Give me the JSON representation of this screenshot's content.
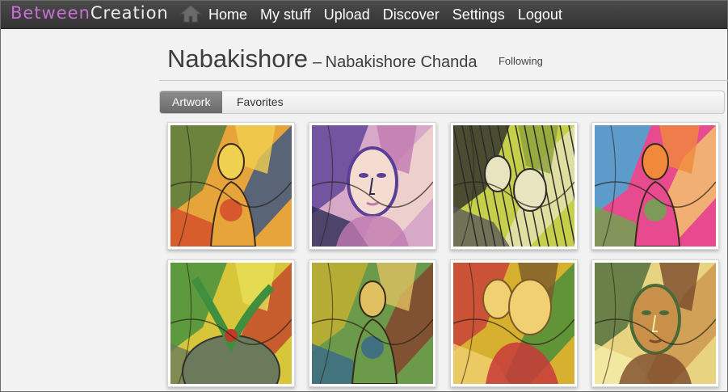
{
  "logo": {
    "part1": "Between",
    "part2": "Creation"
  },
  "nav": {
    "home_icon": "home-icon",
    "items": [
      "Home",
      "My stuff",
      "Upload",
      "Discover",
      "Settings",
      "Logout"
    ]
  },
  "profile": {
    "username": "Nabakishore",
    "dash": "–",
    "full_name": "Nabakishore Chanda",
    "follow_status": "Following"
  },
  "tabs": [
    "Artwork",
    "Favorites"
  ],
  "artworks": [
    {
      "palette": [
        "#e7a43a",
        "#4d7a3f",
        "#2a4f8c",
        "#d44b2a",
        "#f0d050"
      ],
      "kind": "figure"
    },
    {
      "palette": [
        "#d8a8c8",
        "#5a3f96",
        "#f4dcd0",
        "#2a2a55",
        "#c07ab0"
      ],
      "kind": "portrait"
    },
    {
      "palette": [
        "#c6cf4a",
        "#2a2a2a",
        "#e8e4c0",
        "#5a5a5a",
        "#8aa03a"
      ],
      "kind": "lines"
    },
    {
      "palette": [
        "#e84a8f",
        "#3ab0d8",
        "#f4d16a",
        "#6aa84f",
        "#f08a3a"
      ],
      "kind": "figure"
    },
    {
      "palette": [
        "#d8c63a",
        "#3f8f3f",
        "#c23a2a",
        "#6a7a5a",
        "#e8e05a"
      ],
      "kind": "globe"
    },
    {
      "palette": [
        "#6a9a4a",
        "#c8b030",
        "#8a3a2a",
        "#3a6a8a",
        "#e0c060"
      ],
      "kind": "figure"
    },
    {
      "palette": [
        "#d8b030",
        "#c83a3a",
        "#3a8a3a",
        "#f0d070",
        "#7a5a2a"
      ],
      "kind": "embrace"
    },
    {
      "palette": [
        "#e8d480",
        "#4a6a3a",
        "#c89048",
        "#f4eca8",
        "#7a4a2a"
      ],
      "kind": "portrait"
    }
  ]
}
